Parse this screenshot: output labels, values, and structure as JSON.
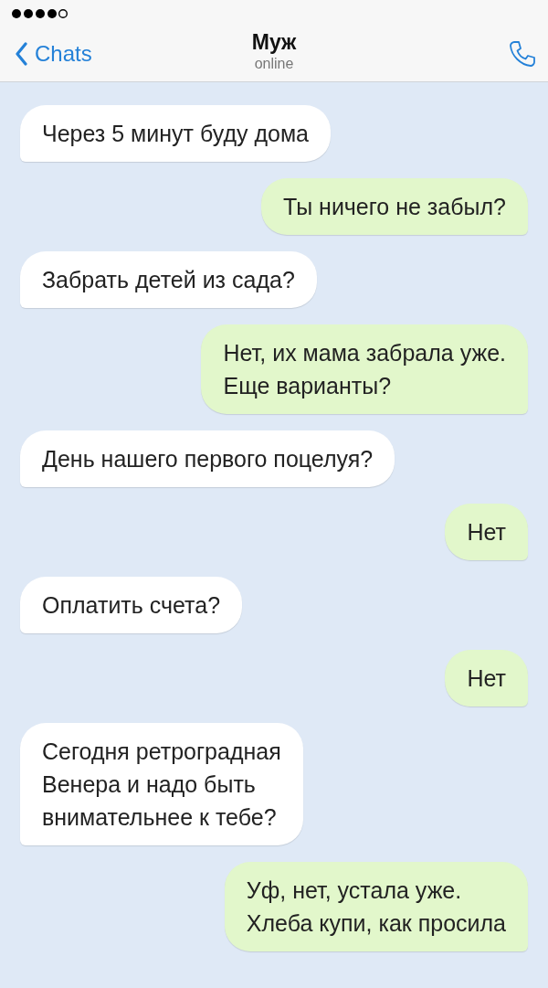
{
  "header": {
    "back": "Chats",
    "title": "Муж",
    "status": "online"
  },
  "messages": [
    {
      "kind": "incoming",
      "text": "Через 5 минут буду дома"
    },
    {
      "kind": "outgoing",
      "text": "Ты ничего не забыл?"
    },
    {
      "kind": "incoming",
      "text": "Забрать детей из сада?"
    },
    {
      "kind": "outgoing",
      "text": "Нет, их мама забрала уже.\nЕще варианты?"
    },
    {
      "kind": "incoming",
      "text": "День нашего первого поцелуя?"
    },
    {
      "kind": "outgoing",
      "text": "Нет"
    },
    {
      "kind": "incoming",
      "text": "Оплатить счета?"
    },
    {
      "kind": "outgoing",
      "text": "Нет"
    },
    {
      "kind": "incoming",
      "text": "Сегодня ретроградная\nВенера и надо быть\nвнимательнее к тебе?"
    },
    {
      "kind": "outgoing",
      "text": "Уф, нет, устала уже.\nХлеба купи, как просила"
    }
  ]
}
